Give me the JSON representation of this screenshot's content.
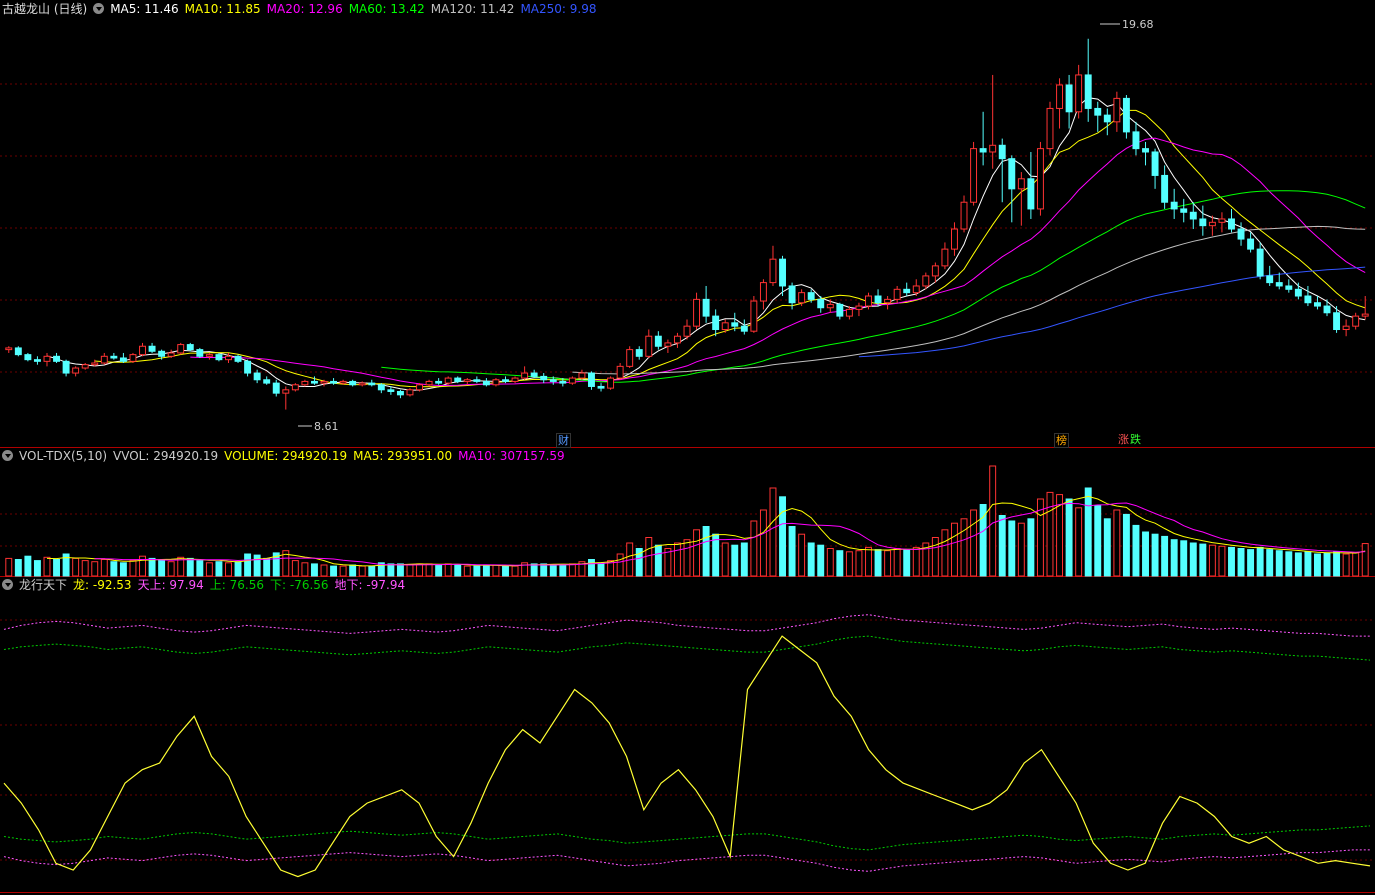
{
  "main": {
    "title": "古越龙山 (日线)",
    "indicators": [
      {
        "label": "MA5: 11.46",
        "color": "#ffffff"
      },
      {
        "label": "MA10: 11.85",
        "color": "#ffff00"
      },
      {
        "label": "MA20: 12.96",
        "color": "#ff00ff"
      },
      {
        "label": "MA60: 13.42",
        "color": "#00ff00"
      },
      {
        "label": "MA120: 11.42",
        "color": "#c0c0c0"
      },
      {
        "label": "MA250: 9.98",
        "color": "#3355ff"
      }
    ],
    "high_label": "19.68",
    "low_label": "8.61",
    "markers": [
      {
        "text": "财",
        "color": "#5599ff"
      },
      {
        "text": "榜",
        "color": "#ffaa00"
      },
      {
        "text": "涨",
        "color": "#ff5555"
      },
      {
        "text": "跌",
        "color": "#33ff33"
      }
    ]
  },
  "volume": {
    "title": "VOL-TDX(5,10)",
    "indicators": [
      {
        "label": "VVOL: 294920.19",
        "color": "#cccccc"
      },
      {
        "label": "VOLUME: 294920.19",
        "color": "#ffff00"
      },
      {
        "label": "MA5: 293951.00",
        "color": "#ffff00"
      },
      {
        "label": "MA10: 307157.59",
        "color": "#ff00ff"
      }
    ]
  },
  "oscillator": {
    "title": "龙行天下",
    "indicators": [
      {
        "label": "龙: -92.53",
        "color": "#ffff00"
      },
      {
        "label": "天上: 97.94",
        "color": "#ff55ff"
      },
      {
        "label": "上: 76.56",
        "color": "#00cc00"
      },
      {
        "label": "下: -76.56",
        "color": "#00cc00"
      },
      {
        "label": "地下: -97.94",
        "color": "#ff55ff"
      }
    ]
  },
  "chart_data": {
    "type": "candlestick",
    "price_range": [
      8.0,
      20.3
    ],
    "volume_max": 1000000,
    "oscillator_range": [
      -110,
      110
    ],
    "colors": {
      "up": "#ff3333",
      "down": "#54ffff",
      "grid": "#6b0000"
    },
    "bars": [
      [
        10.4,
        10.5,
        10.3,
        10.45,
        160000
      ],
      [
        10.45,
        10.5,
        10.2,
        10.25,
        150000
      ],
      [
        10.25,
        10.3,
        10.05,
        10.1,
        180000
      ],
      [
        10.1,
        10.2,
        9.95,
        10.05,
        140000
      ],
      [
        10.05,
        10.3,
        9.9,
        10.2,
        170000
      ],
      [
        10.2,
        10.3,
        10.0,
        10.05,
        150000
      ],
      [
        10.05,
        10.1,
        9.6,
        9.7,
        200000
      ],
      [
        9.7,
        9.9,
        9.6,
        9.85,
        160000
      ],
      [
        9.85,
        10.0,
        9.8,
        9.95,
        140000
      ],
      [
        9.95,
        10.1,
        9.9,
        10.0,
        130000
      ],
      [
        10.0,
        10.3,
        9.95,
        10.2,
        150000
      ],
      [
        10.2,
        10.3,
        10.1,
        10.15,
        130000
      ],
      [
        10.15,
        10.3,
        10.0,
        10.05,
        120000
      ],
      [
        10.05,
        10.3,
        10.0,
        10.25,
        140000
      ],
      [
        10.25,
        10.6,
        10.2,
        10.5,
        180000
      ],
      [
        10.5,
        10.6,
        10.3,
        10.35,
        160000
      ],
      [
        10.35,
        10.4,
        10.1,
        10.2,
        150000
      ],
      [
        10.2,
        10.4,
        10.15,
        10.3,
        130000
      ],
      [
        10.3,
        10.6,
        10.25,
        10.55,
        170000
      ],
      [
        10.55,
        10.6,
        10.35,
        10.4,
        160000
      ],
      [
        10.4,
        10.45,
        10.15,
        10.2,
        140000
      ],
      [
        10.2,
        10.3,
        10.1,
        10.25,
        120000
      ],
      [
        10.25,
        10.3,
        10.05,
        10.1,
        130000
      ],
      [
        10.1,
        10.3,
        10.0,
        10.2,
        120000
      ],
      [
        10.2,
        10.25,
        10.0,
        10.05,
        130000
      ],
      [
        10.05,
        10.1,
        9.6,
        9.7,
        200000
      ],
      [
        9.7,
        9.8,
        9.4,
        9.5,
        190000
      ],
      [
        9.5,
        9.6,
        9.35,
        9.4,
        160000
      ],
      [
        9.4,
        9.5,
        9.0,
        9.1,
        210000
      ],
      [
        9.1,
        9.3,
        8.61,
        9.2,
        230000
      ],
      [
        9.2,
        9.4,
        9.15,
        9.35,
        140000
      ],
      [
        9.35,
        9.5,
        9.3,
        9.45,
        120000
      ],
      [
        9.45,
        9.6,
        9.35,
        9.4,
        110000
      ],
      [
        9.4,
        9.5,
        9.3,
        9.45,
        100000
      ],
      [
        9.45,
        9.55,
        9.35,
        9.4,
        90000
      ],
      [
        9.4,
        9.5,
        9.35,
        9.45,
        90000
      ],
      [
        9.45,
        9.5,
        9.3,
        9.35,
        100000
      ],
      [
        9.35,
        9.45,
        9.3,
        9.4,
        90000
      ],
      [
        9.4,
        9.5,
        9.3,
        9.35,
        90000
      ],
      [
        9.35,
        9.4,
        9.1,
        9.2,
        120000
      ],
      [
        9.2,
        9.3,
        9.05,
        9.15,
        110000
      ],
      [
        9.15,
        9.2,
        8.95,
        9.05,
        110000
      ],
      [
        9.05,
        9.25,
        9.0,
        9.2,
        100000
      ],
      [
        9.2,
        9.4,
        9.15,
        9.35,
        110000
      ],
      [
        9.35,
        9.5,
        9.3,
        9.45,
        110000
      ],
      [
        9.45,
        9.55,
        9.35,
        9.4,
        100000
      ],
      [
        9.4,
        9.6,
        9.35,
        9.55,
        110000
      ],
      [
        9.55,
        9.6,
        9.4,
        9.45,
        100000
      ],
      [
        9.45,
        9.55,
        9.35,
        9.5,
        90000
      ],
      [
        9.5,
        9.6,
        9.4,
        9.45,
        90000
      ],
      [
        9.45,
        9.55,
        9.3,
        9.35,
        100000
      ],
      [
        9.35,
        9.55,
        9.3,
        9.5,
        100000
      ],
      [
        9.5,
        9.6,
        9.4,
        9.45,
        90000
      ],
      [
        9.45,
        9.6,
        9.4,
        9.55,
        90000
      ],
      [
        9.55,
        9.9,
        9.5,
        9.7,
        120000
      ],
      [
        9.7,
        9.8,
        9.55,
        9.6,
        110000
      ],
      [
        9.6,
        9.7,
        9.4,
        9.5,
        110000
      ],
      [
        9.5,
        9.6,
        9.35,
        9.45,
        100000
      ],
      [
        9.45,
        9.55,
        9.3,
        9.4,
        100000
      ],
      [
        9.4,
        9.6,
        9.35,
        9.55,
        110000
      ],
      [
        9.55,
        9.8,
        9.5,
        9.7,
        130000
      ],
      [
        9.7,
        9.75,
        9.2,
        9.3,
        150000
      ],
      [
        9.3,
        9.4,
        9.15,
        9.25,
        120000
      ],
      [
        9.25,
        9.6,
        9.2,
        9.55,
        140000
      ],
      [
        9.55,
        10.0,
        9.5,
        9.9,
        200000
      ],
      [
        9.9,
        10.5,
        9.85,
        10.4,
        300000
      ],
      [
        10.4,
        10.5,
        10.1,
        10.2,
        250000
      ],
      [
        10.2,
        11.0,
        10.15,
        10.8,
        350000
      ],
      [
        10.8,
        10.95,
        10.4,
        10.5,
        280000
      ],
      [
        10.5,
        10.7,
        10.3,
        10.6,
        250000
      ],
      [
        10.6,
        10.9,
        10.45,
        10.8,
        300000
      ],
      [
        10.8,
        11.3,
        10.7,
        11.1,
        330000
      ],
      [
        11.1,
        12.1,
        11.0,
        11.9,
        420000
      ],
      [
        11.9,
        12.3,
        11.2,
        11.4,
        450000
      ],
      [
        11.4,
        11.6,
        10.8,
        11.0,
        380000
      ],
      [
        11.0,
        11.3,
        10.9,
        11.2,
        300000
      ],
      [
        11.2,
        11.5,
        10.95,
        11.1,
        280000
      ],
      [
        11.1,
        11.3,
        10.85,
        10.95,
        300000
      ],
      [
        10.95,
        12.0,
        10.9,
        11.85,
        500000
      ],
      [
        11.85,
        12.5,
        11.6,
        12.4,
        600000
      ],
      [
        12.4,
        13.5,
        12.3,
        13.1,
        800000
      ],
      [
        13.1,
        13.2,
        12.0,
        12.3,
        720000
      ],
      [
        12.3,
        12.4,
        11.6,
        11.8,
        450000
      ],
      [
        11.8,
        12.2,
        11.7,
        12.1,
        380000
      ],
      [
        12.1,
        12.2,
        11.8,
        11.9,
        300000
      ],
      [
        11.9,
        12.0,
        11.5,
        11.65,
        280000
      ],
      [
        11.65,
        11.9,
        11.5,
        11.75,
        250000
      ],
      [
        11.75,
        11.8,
        11.3,
        11.4,
        230000
      ],
      [
        11.4,
        11.7,
        11.3,
        11.6,
        220000
      ],
      [
        11.6,
        11.8,
        11.4,
        11.7,
        230000
      ],
      [
        11.7,
        12.1,
        11.6,
        12.0,
        260000
      ],
      [
        12.0,
        12.2,
        11.7,
        11.8,
        240000
      ],
      [
        11.8,
        12.0,
        11.6,
        11.9,
        230000
      ],
      [
        11.9,
        12.3,
        11.8,
        12.2,
        250000
      ],
      [
        12.2,
        12.4,
        12.0,
        12.1,
        240000
      ],
      [
        12.1,
        12.5,
        12.0,
        12.3,
        260000
      ],
      [
        12.3,
        12.7,
        12.2,
        12.6,
        300000
      ],
      [
        12.6,
        13.0,
        12.4,
        12.9,
        350000
      ],
      [
        12.9,
        13.6,
        12.8,
        13.4,
        420000
      ],
      [
        13.4,
        14.2,
        13.2,
        14.0,
        480000
      ],
      [
        14.0,
        15.0,
        13.9,
        14.8,
        520000
      ],
      [
        14.8,
        16.6,
        14.7,
        16.4,
        600000
      ],
      [
        16.4,
        17.5,
        15.9,
        16.3,
        650000
      ],
      [
        16.3,
        18.6,
        15.8,
        16.5,
        1000000
      ],
      [
        16.5,
        16.7,
        14.8,
        16.1,
        550000
      ],
      [
        16.1,
        16.2,
        14.2,
        15.2,
        500000
      ],
      [
        15.2,
        15.7,
        14.1,
        15.5,
        480000
      ],
      [
        15.5,
        16.3,
        14.3,
        14.6,
        520000
      ],
      [
        14.6,
        16.6,
        14.4,
        16.4,
        700000
      ],
      [
        16.4,
        17.8,
        16.2,
        17.6,
        760000
      ],
      [
        17.6,
        18.5,
        17.0,
        18.3,
        740000
      ],
      [
        18.3,
        18.6,
        17.0,
        17.5,
        700000
      ],
      [
        17.5,
        18.9,
        17.3,
        18.6,
        620000
      ],
      [
        18.6,
        19.68,
        17.2,
        17.6,
        800000
      ],
      [
        17.6,
        17.8,
        16.9,
        17.4,
        640000
      ],
      [
        17.4,
        17.6,
        16.8,
        17.2,
        520000
      ],
      [
        17.2,
        18.1,
        16.9,
        17.9,
        600000
      ],
      [
        17.9,
        18.0,
        16.7,
        16.9,
        560000
      ],
      [
        16.9,
        17.2,
        16.2,
        16.4,
        460000
      ],
      [
        16.4,
        16.6,
        15.9,
        16.3,
        400000
      ],
      [
        16.3,
        16.4,
        15.2,
        15.6,
        380000
      ],
      [
        15.6,
        15.9,
        14.6,
        14.8,
        360000
      ],
      [
        14.8,
        15.2,
        14.3,
        14.6,
        330000
      ],
      [
        14.6,
        14.9,
        14.2,
        14.5,
        320000
      ],
      [
        14.5,
        14.8,
        14.0,
        14.3,
        300000
      ],
      [
        14.3,
        14.7,
        13.8,
        14.1,
        290000
      ],
      [
        14.1,
        14.4,
        13.8,
        14.2,
        280000
      ],
      [
        14.2,
        14.5,
        13.9,
        14.3,
        270000
      ],
      [
        14.3,
        14.6,
        13.9,
        14.0,
        260000
      ],
      [
        14.0,
        14.2,
        13.5,
        13.7,
        250000
      ],
      [
        13.7,
        13.9,
        13.3,
        13.4,
        240000
      ],
      [
        13.4,
        13.6,
        12.5,
        12.6,
        260000
      ],
      [
        12.6,
        12.9,
        12.3,
        12.4,
        240000
      ],
      [
        12.4,
        12.7,
        12.2,
        12.3,
        230000
      ],
      [
        12.3,
        12.5,
        12.1,
        12.2,
        220000
      ],
      [
        12.2,
        12.4,
        11.9,
        12.0,
        210000
      ],
      [
        12.0,
        12.3,
        11.7,
        11.8,
        220000
      ],
      [
        11.8,
        12.0,
        11.6,
        11.7,
        200000
      ],
      [
        11.7,
        11.9,
        11.4,
        11.5,
        210000
      ],
      [
        11.5,
        11.7,
        10.9,
        11.0,
        220000
      ],
      [
        11.0,
        11.3,
        10.8,
        11.1,
        200000
      ],
      [
        11.1,
        11.5,
        11.0,
        11.4,
        210000
      ],
      [
        11.4,
        12.0,
        11.3,
        11.46,
        294920
      ]
    ],
    "oscillator": {
      "long": [
        -30,
        -45,
        -65,
        -90,
        -95,
        -80,
        -55,
        -30,
        -20,
        -15,
        5,
        20,
        -10,
        -25,
        -55,
        -75,
        -95,
        -100,
        -95,
        -75,
        -55,
        -45,
        -40,
        -35,
        -45,
        -70,
        -85,
        -60,
        -30,
        -5,
        10,
        0,
        20,
        40,
        30,
        15,
        -10,
        -50,
        -30,
        -20,
        -35,
        -55,
        -85,
        40,
        60,
        80,
        70,
        60,
        35,
        20,
        -5,
        -20,
        -30,
        -35,
        -40,
        -45,
        -50,
        -45,
        -35,
        -15,
        -5,
        -25,
        -45,
        -75,
        -90,
        -95,
        -90,
        -60,
        -40,
        -45,
        -55,
        -70,
        -75,
        -70,
        -80,
        -85,
        -90,
        -88,
        -90,
        -92
      ],
      "up_outer": [
        85,
        88,
        90,
        91,
        90,
        88,
        86,
        87,
        88,
        86,
        84,
        83,
        84,
        86,
        88,
        87,
        86,
        85,
        84,
        83,
        82,
        83,
        84,
        85,
        84,
        83,
        84,
        86,
        88,
        87,
        86,
        85,
        84,
        86,
        88,
        90,
        92,
        91,
        90,
        88,
        87,
        86,
        85,
        84,
        84,
        86,
        88,
        90,
        93,
        95,
        96,
        94,
        92,
        91,
        90,
        89,
        88,
        87,
        86,
        85,
        86,
        88,
        90,
        89,
        88,
        87,
        88,
        89,
        87,
        86,
        85,
        86,
        85,
        84,
        83,
        82,
        82,
        81,
        80,
        80
      ],
      "up_inner": [
        70,
        72,
        73,
        74,
        73,
        72,
        70,
        71,
        72,
        70,
        68,
        67,
        68,
        70,
        72,
        71,
        70,
        69,
        68,
        67,
        66,
        67,
        68,
        69,
        68,
        67,
        68,
        70,
        72,
        71,
        70,
        69,
        68,
        70,
        72,
        73,
        75,
        74,
        73,
        72,
        71,
        70,
        69,
        68,
        68,
        70,
        72,
        74,
        77,
        79,
        80,
        78,
        76,
        75,
        74,
        73,
        72,
        71,
        70,
        69,
        70,
        72,
        73,
        72,
        71,
        70,
        71,
        72,
        70,
        69,
        68,
        69,
        68,
        67,
        66,
        65,
        65,
        64,
        63,
        62
      ]
    }
  }
}
